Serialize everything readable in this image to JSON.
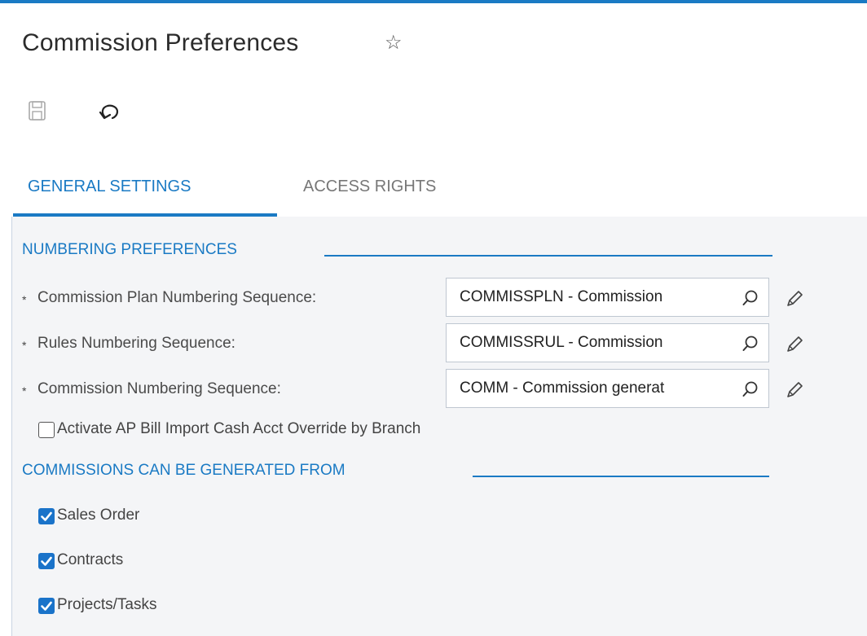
{
  "page": {
    "title": "Commission Preferences"
  },
  "tabs": [
    {
      "label": "GENERAL SETTINGS",
      "active": true
    },
    {
      "label": "ACCESS RIGHTS",
      "active": false
    }
  ],
  "numbering": {
    "header": "NUMBERING PREFERENCES",
    "fields": [
      {
        "label": "Commission Plan Numbering Sequence:",
        "value": "COMMISSPLN - Commission",
        "required": true
      },
      {
        "label": "Rules Numbering Sequence:",
        "value": "COMMISSRUL - Commission",
        "required": true
      },
      {
        "label": "Commission Numbering Sequence:",
        "value": "COMM - Commission generat",
        "required": true
      }
    ],
    "required_marker": "*",
    "override_checkbox": {
      "label": "Activate AP Bill Import Cash Acct Override by Branch",
      "checked": false
    }
  },
  "generated_from": {
    "header": "COMMISSIONS CAN BE GENERATED FROM",
    "options": [
      {
        "label": "Sales Order",
        "checked": true
      },
      {
        "label": "Contracts",
        "checked": true
      },
      {
        "label": "Projects/Tasks",
        "checked": true
      }
    ]
  },
  "colors": {
    "accent": "#1a7ac4",
    "checkbox": "#1a73c9",
    "panel_bg": "#f4f5f7"
  },
  "icons": {
    "favorite": "star-outline-icon",
    "save": "save-icon",
    "undo": "undo-icon",
    "lookup": "search-icon",
    "edit": "pencil-icon"
  }
}
